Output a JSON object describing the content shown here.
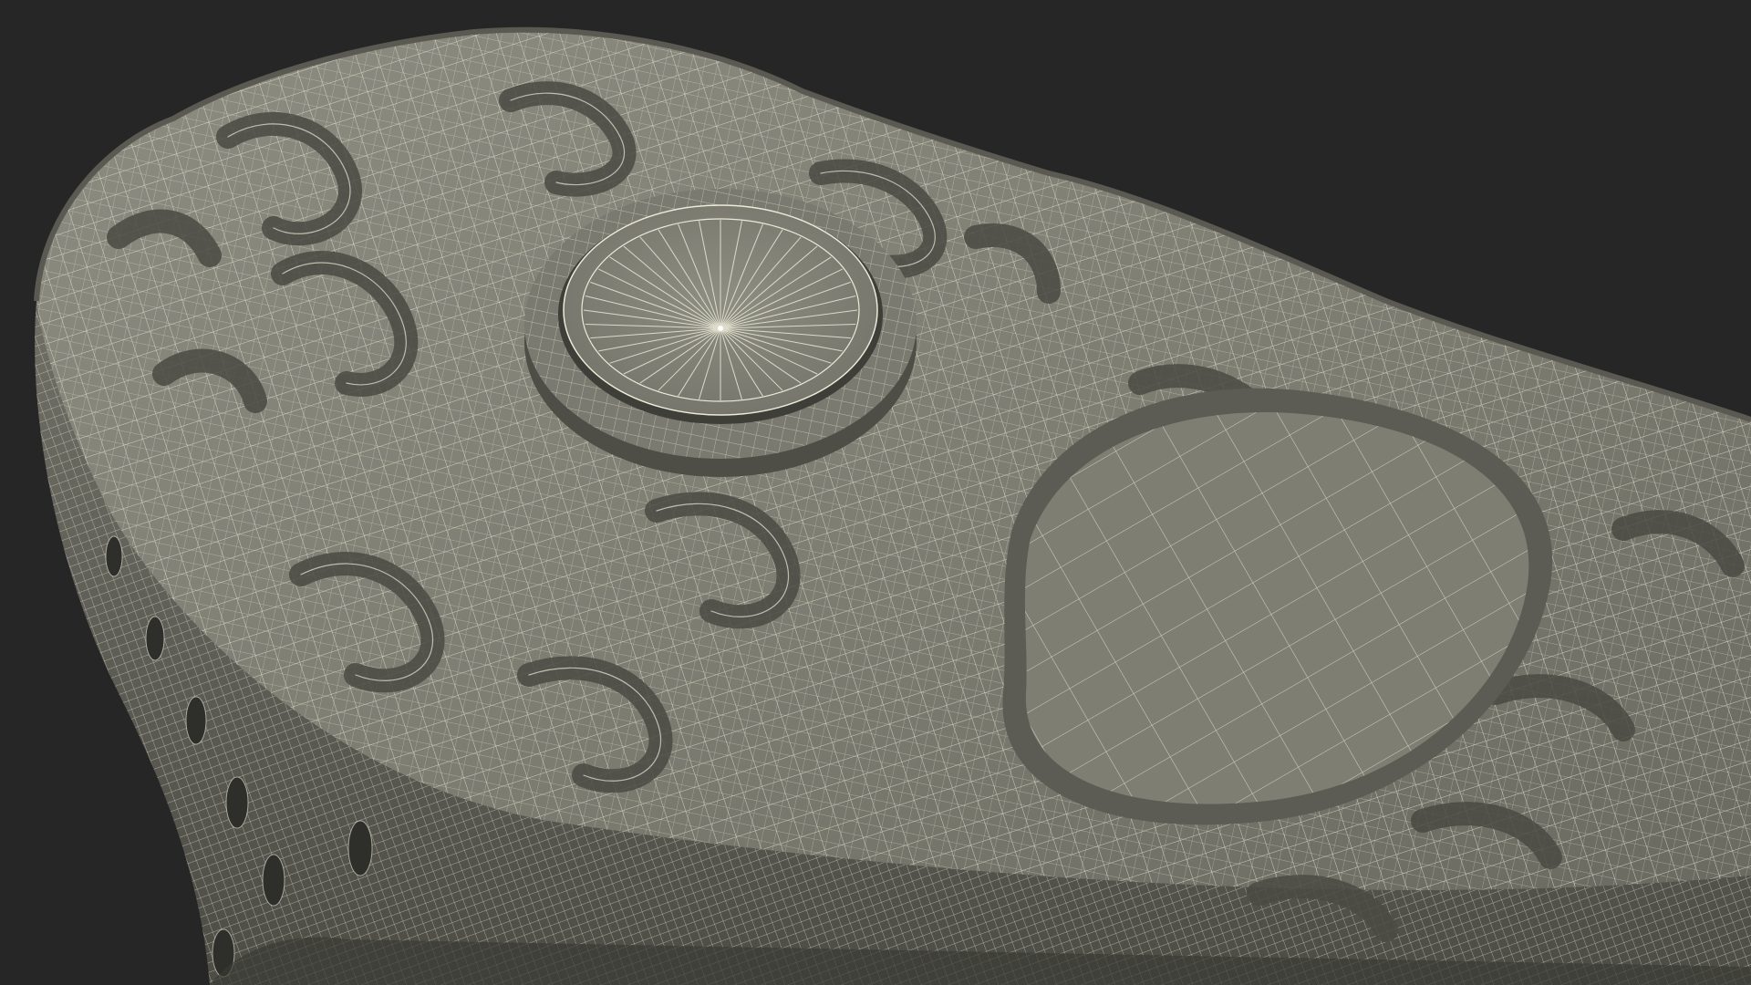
{
  "render": {
    "subject": "wireframe-shoe-sole-render",
    "colors": {
      "background": "#262626",
      "surface": "#7f7f74",
      "surface_light": "#8b8b80",
      "surface_dark": "#55554d",
      "shadow": "#3e3e39",
      "wire": "#ecebd9"
    },
    "features": [
      "circular-pivot-pad",
      "oval-heel-pad",
      "lug-pattern",
      "side-wall-holes"
    ]
  }
}
